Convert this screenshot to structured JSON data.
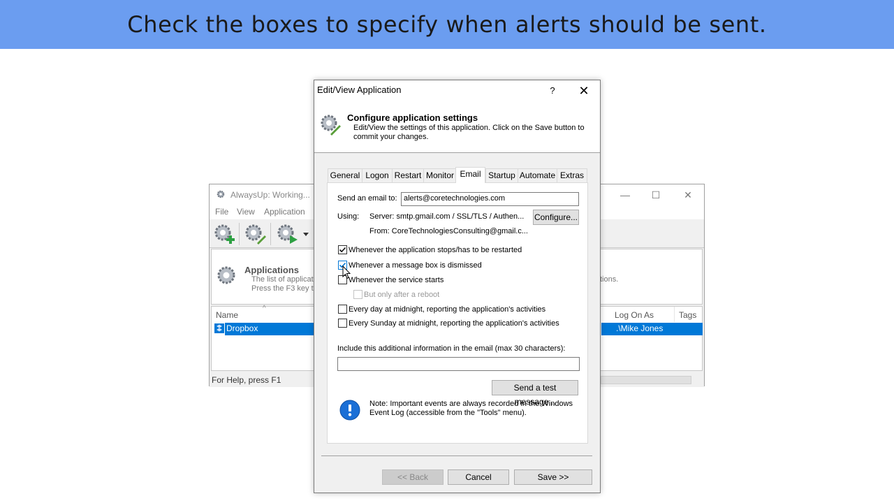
{
  "banner": {
    "text": "Check the boxes to specify when alerts should be sent."
  },
  "background_window": {
    "title": "AlwaysUp: Working...",
    "menu": [
      "File",
      "View",
      "Application"
    ],
    "header_title": "Applications",
    "header_desc": "The list of applicatio\nPress the F3 key to",
    "header_desc_right": "tions.",
    "columns": [
      "Name",
      "Log On As",
      "Tags"
    ],
    "row": {
      "name": "Dropbox",
      "logon": ".\\Mike Jones"
    },
    "status": "For Help, press F1"
  },
  "dialog": {
    "title": "Edit/View Application",
    "help": "?",
    "header_title": "Configure application settings",
    "header_subtitle": "Edit/View the settings of this application. Click on the Save button to commit your changes.",
    "tabs": [
      "General",
      "Logon",
      "Restart",
      "Monitor",
      "Email",
      "Startup",
      "Automate",
      "Extras"
    ],
    "active_tab": "Email",
    "email": {
      "send_label": "Send an email to:",
      "send_value": "alerts@coretechnologies.com",
      "using_label": "Using:",
      "server_text": "Server: smtp.gmail.com / SSL/TLS / Authen...",
      "from_text": "From: CoreTechnologiesConsulting@gmail.c...",
      "configure_button": "Configure...",
      "checkboxes": [
        {
          "label": "Whenever the application stops/has to be restarted",
          "checked": true,
          "enabled": true
        },
        {
          "label": "Whenever a message box is dismissed",
          "checked": true,
          "enabled": true
        },
        {
          "label": "Whenever the service starts",
          "checked": false,
          "enabled": true
        },
        {
          "label": "But only after a reboot",
          "checked": false,
          "enabled": false
        },
        {
          "label": "Every day at midnight, reporting the application's activities",
          "checked": false,
          "enabled": true
        },
        {
          "label": "Every Sunday at midnight, reporting the application's activities",
          "checked": false,
          "enabled": true
        }
      ],
      "additional_label": "Include this additional information in the email (max 30 characters):",
      "additional_value": "",
      "test_button": "Send a test message...",
      "note": "Note: Important events are always recorded in the Windows Event Log (accessible from the \"Tools\" menu)."
    },
    "buttons": {
      "back": "<< Back",
      "cancel": "Cancel",
      "save": "Save >>"
    }
  },
  "colors": {
    "banner": "#6b9df0",
    "selection": "#0078d7",
    "info_icon": "#1a6fd6"
  }
}
